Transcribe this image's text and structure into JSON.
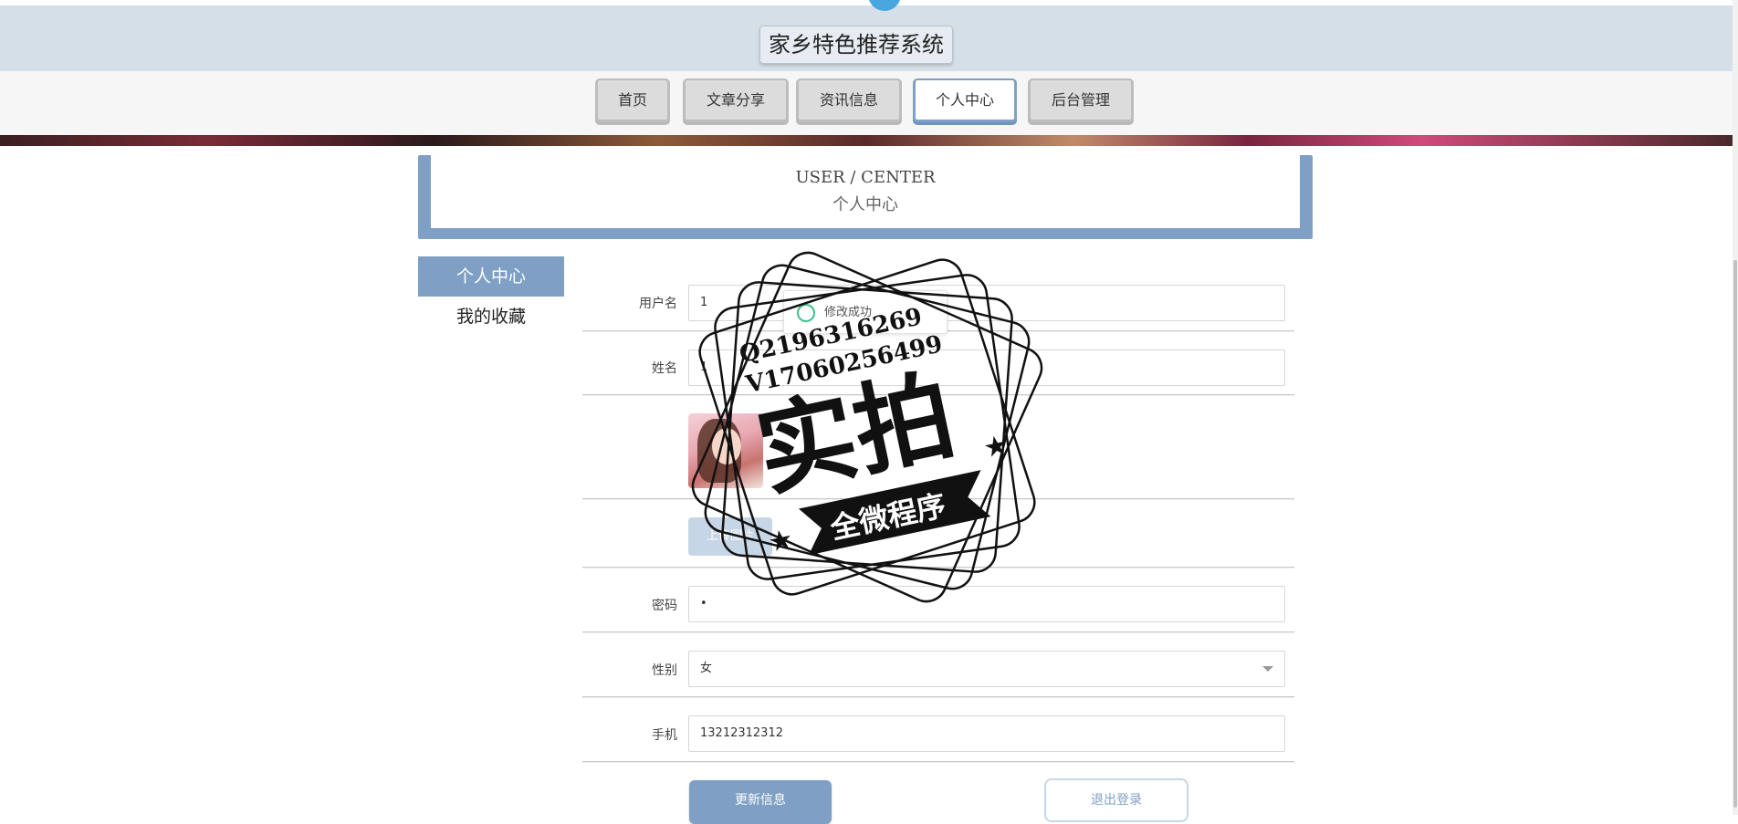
{
  "header": {
    "site_title": "家乡特色推荐系统"
  },
  "nav": {
    "tabs": [
      {
        "label": "首页"
      },
      {
        "label": "文章分享"
      },
      {
        "label": "资讯信息"
      },
      {
        "label": "个人中心"
      },
      {
        "label": "后台管理"
      }
    ],
    "active": "个人中心"
  },
  "section": {
    "title_en": "USER / CENTER",
    "title_cn": "个人中心"
  },
  "side_menu": {
    "items": [
      {
        "label": "个人中心"
      },
      {
        "label": "我的收藏"
      }
    ]
  },
  "form": {
    "username_label": "用户名",
    "username_value": "1",
    "name_label": "姓名",
    "name_value": "1",
    "upload_label": "上传图片",
    "password_label": "密码",
    "password_value": "•",
    "gender_label": "性别",
    "gender_value": "女",
    "phone_label": "手机",
    "phone_value": "13212312312"
  },
  "toast": {
    "text": "修改成功"
  },
  "actions": {
    "update_label": "更新信息",
    "logout_label": "退出登录"
  },
  "watermark": {
    "line1": "Q2196316269",
    "line2": "V17060256499",
    "main": "实拍",
    "ribbon": "全微程序"
  },
  "colors": {
    "accent": "#7fa0c4",
    "header_bg": "#d5dfe7",
    "toast_icon": "#3cc08a"
  }
}
